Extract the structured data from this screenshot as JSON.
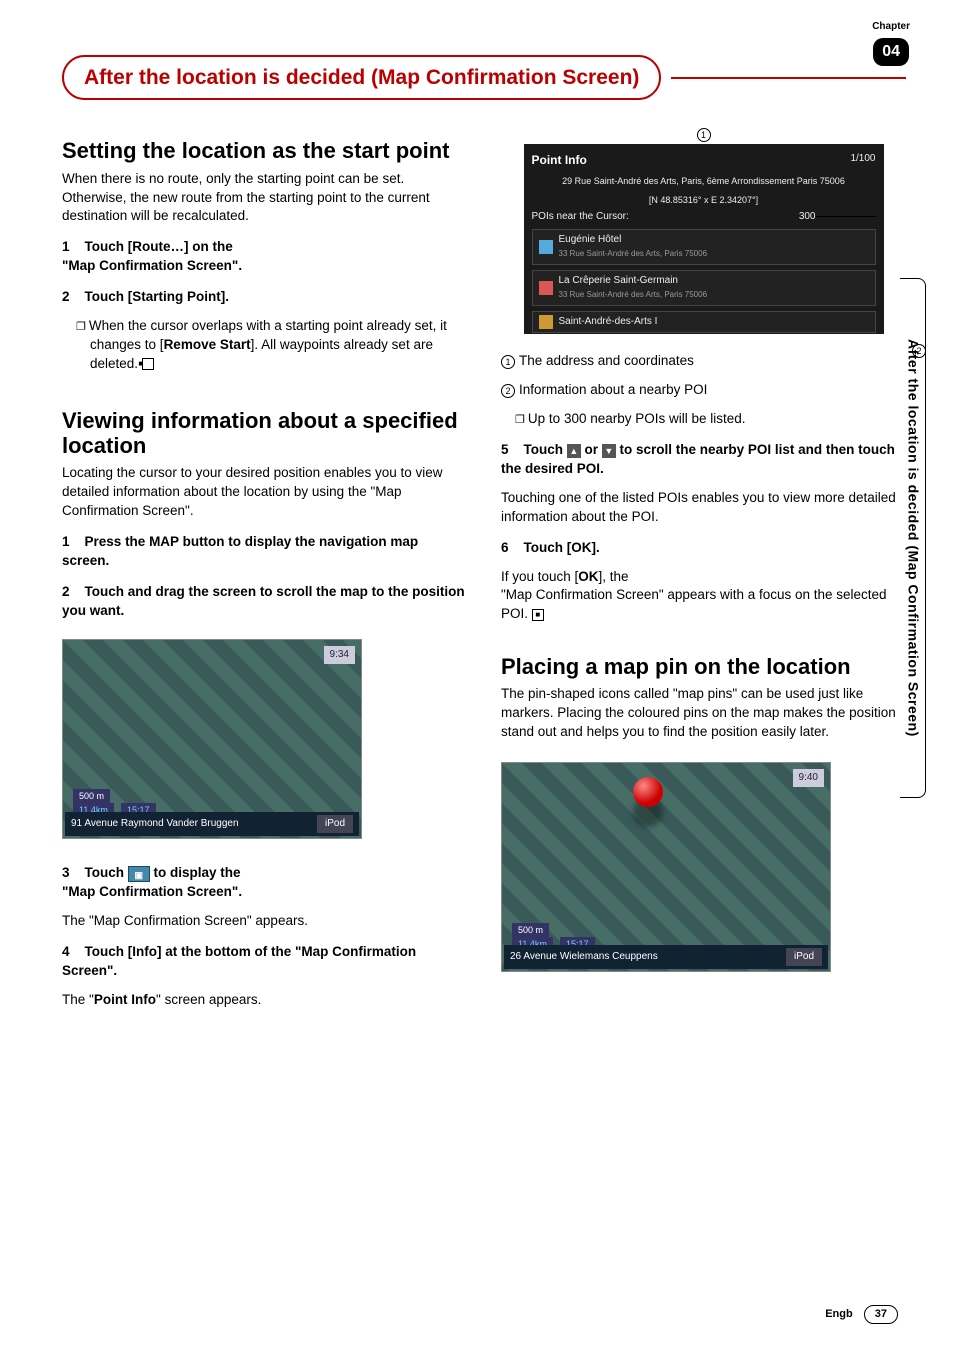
{
  "chapter": {
    "label": "Chapter",
    "number": "04"
  },
  "page_title": "After the location is decided (Map Confirmation Screen)",
  "vertical_tab": "After the location is decided (Map Confirmation Screen)",
  "footer": {
    "lang": "Engb",
    "page": "37"
  },
  "left": {
    "h1": "Setting the location as the start point",
    "p1": "When there is no route, only the starting point can be set. Otherwise, the new route from the starting point to the current destination will be recalculated.",
    "s1a": "1",
    "s1b": "Touch [Route…] on the",
    "s1c": "\"Map Confirmation Screen\".",
    "s2a": "2",
    "s2b": "Touch [Starting Point].",
    "s2sub_a": "When the cursor overlaps with a starting point already set, it changes to [",
    "s2sub_b": "Remove Start",
    "s2sub_c": "]. All waypoints already set are deleted.",
    "h2": "Viewing information about a specified location",
    "p2": "Locating the cursor to your desired position enables you to view detailed information about the location by using the \"Map Confirmation Screen\".",
    "v1a": "1",
    "v1b": "Press the MAP button to display the navigation map screen.",
    "v2a": "2",
    "v2b": "Touch and drag the screen to scroll the map to the position you want.",
    "map_overlay": {
      "addr": "91 Avenue Raymond Vander Bruggen",
      "dist": "11.4km",
      "time": "15:17",
      "scale": "500 m",
      "clock": "9:34",
      "btn": "iPod"
    },
    "v3a": "3",
    "v3b": "Touch ",
    "v3c": " to display the",
    "v3d": "\"Map Confirmation Screen\".",
    "v3e": "The \"Map Confirmation Screen\" appears.",
    "v4a": "4",
    "v4b": "Touch [Info] at the bottom of the \"Map Confirmation Screen\".",
    "v4c_a": "The \"",
    "v4c_b": "Point Info",
    "v4c_c": "\" screen appears."
  },
  "right": {
    "c1": "1",
    "c2": "2",
    "point": {
      "title": "Point Info",
      "count": "1/100",
      "addr": "29 Rue Saint-André des Arts, Paris, 6ème Arrondissement Paris 75006",
      "coords": "[N 48.85316° x E 2.34207°]",
      "near": "POIs near the Cursor:",
      "radius": "300",
      "poi1": "Eugénie Hôtel",
      "poi1s": "33 Rue Saint-André des Arts, Paris 75006",
      "poi2": "La Crêperie Saint-Germain",
      "poi2s": "33 Rue Saint-André des Arts, Paris 75006",
      "poi3": "Saint-André-des-Arts I"
    },
    "l1": "The address and coordinates",
    "l2": "Information about a nearby POI",
    "l3": "Up to 300 nearby POIs will be listed.",
    "s5a": "5",
    "s5b": "Touch ",
    "s5c": " or ",
    "s5d": " to scroll the nearby POI list and then touch the desired POI.",
    "s5e": "Touching one of the listed POIs enables you to view more detailed information about the POI.",
    "s6a": "6",
    "s6b": "Touch [OK].",
    "s6c_a": "If you touch [",
    "s6c_b": "OK",
    "s6c_c": "], the",
    "s6d": "\"Map Confirmation Screen\" appears with a focus on the selected POI.",
    "h3": "Placing a map pin on the location",
    "p3": "The pin-shaped icons called \"map pins\" can be used just like markers. Placing the coloured pins on the map makes the position stand out and helps you to find the position easily later.",
    "map2": {
      "addr": "26 Avenue Wielemans Ceuppens",
      "dist": "11.4km",
      "time": "15:17",
      "scale": "500 m",
      "clock": "9:40",
      "btn": "iPod"
    }
  }
}
